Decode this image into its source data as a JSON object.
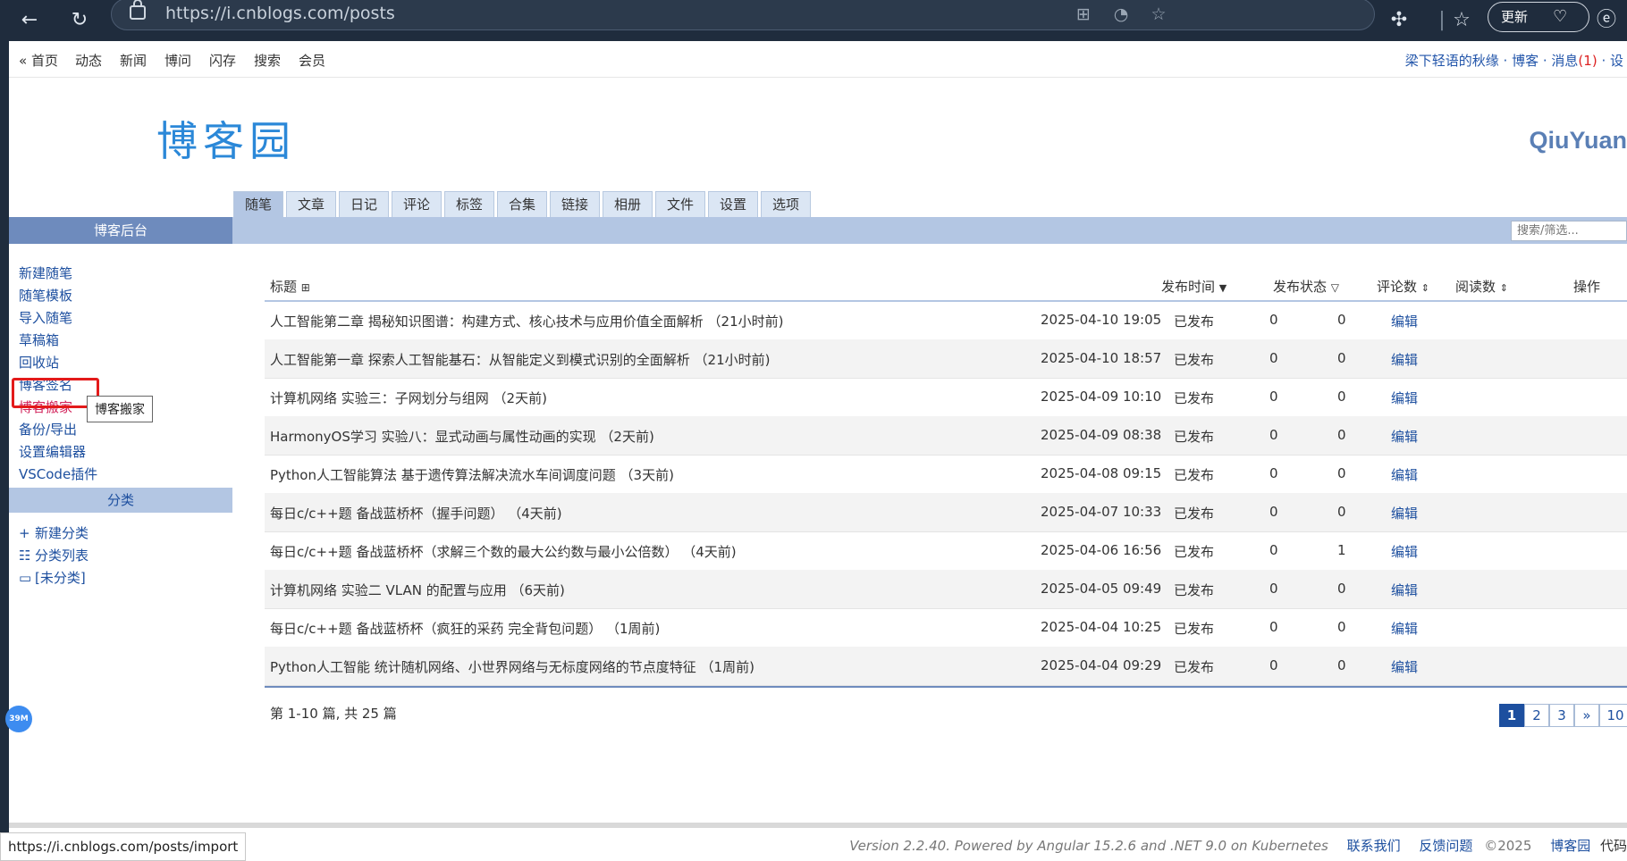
{
  "browser": {
    "url": "https://i.cnblogs.com/posts",
    "update_label": "更新",
    "status_url": "https://i.cnblogs.com/posts/import"
  },
  "topnav": {
    "items": [
      "« 首页",
      "动态",
      "新闻",
      "博问",
      "闪存",
      "搜索",
      "会员"
    ],
    "user": "梁下轻语的秋缘",
    "blog": "博客",
    "messages": "消息",
    "message_count": "(1)",
    "settings": "设"
  },
  "logo": {
    "text": "博客园"
  },
  "blog_name": "QiuYuan",
  "tabs": [
    "随笔",
    "文章",
    "日记",
    "评论",
    "标签",
    "合集",
    "链接",
    "相册",
    "文件",
    "设置",
    "选项"
  ],
  "sidebar": {
    "title": "博客后台",
    "links": [
      "新建随笔",
      "随笔模板",
      "导入随笔",
      "草稿箱",
      "回收站",
      "博客签名",
      "博客搬家",
      "备份/导出",
      "设置编辑器",
      "VSCode插件"
    ],
    "tooltip": "博客搬家",
    "category_title": "分类",
    "category_links": [
      "新建分类",
      "分类列表",
      "[未分类]"
    ],
    "memory_badge": "39M"
  },
  "search": {
    "placeholder": "搜索/筛选..."
  },
  "table": {
    "headers": {
      "title": "标题",
      "date": "发布时间",
      "status": "发布状态",
      "comments": "评论数",
      "reads": "阅读数",
      "action": "操作"
    },
    "rows": [
      {
        "title": "人工智能第二章 揭秘知识图谱：构建方式、核心技术与应用价值全面解析 （21小时前)",
        "date": "2025-04-10 19:05",
        "status": "已发布",
        "comments": "0",
        "reads": "0",
        "action": "编辑"
      },
      {
        "title": "人工智能第一章 探索人工智能基石：从智能定义到模式识别的全面解析 （21小时前)",
        "date": "2025-04-10 18:57",
        "status": "已发布",
        "comments": "0",
        "reads": "0",
        "action": "编辑"
      },
      {
        "title": "计算机网络 实验三：子网划分与组网 （2天前)",
        "date": "2025-04-09 10:10",
        "status": "已发布",
        "comments": "0",
        "reads": "0",
        "action": "编辑"
      },
      {
        "title": "HarmonyOS学习 实验八：显式动画与属性动画的实现 （2天前)",
        "date": "2025-04-09 08:38",
        "status": "已发布",
        "comments": "0",
        "reads": "0",
        "action": "编辑"
      },
      {
        "title": "Python人工智能算法 基于遗传算法解决流水车间调度问题 （3天前)",
        "date": "2025-04-08 09:15",
        "status": "已发布",
        "comments": "0",
        "reads": "0",
        "action": "编辑"
      },
      {
        "title": "每日c/c++题 备战蓝桥杯（握手问题） （4天前)",
        "date": "2025-04-07 10:33",
        "status": "已发布",
        "comments": "0",
        "reads": "0",
        "action": "编辑"
      },
      {
        "title": "每日c/c++题 备战蓝桥杯（求解三个数的最大公约数与最小公倍数） （4天前)",
        "date": "2025-04-06 16:56",
        "status": "已发布",
        "comments": "0",
        "reads": "1",
        "action": "编辑"
      },
      {
        "title": "计算机网络 实验二 VLAN 的配置与应用 （6天前)",
        "date": "2025-04-05 09:49",
        "status": "已发布",
        "comments": "0",
        "reads": "0",
        "action": "编辑"
      },
      {
        "title": "每日c/c++题 备战蓝桥杯（疯狂的采药 完全背包问题） （1周前)",
        "date": "2025-04-04 10:25",
        "status": "已发布",
        "comments": "0",
        "reads": "0",
        "action": "编辑"
      },
      {
        "title": "Python人工智能 统计随机网络、小世界网络与无标度网络的节点度特征 （1周前)",
        "date": "2025-04-04 09:29",
        "status": "已发布",
        "comments": "0",
        "reads": "0",
        "action": "编辑"
      }
    ]
  },
  "pager": {
    "summary": "第 1-10 篇, 共 25 篇",
    "pages": [
      "1",
      "2",
      "3",
      "»",
      "10"
    ],
    "current": "1"
  },
  "footer": {
    "version": "Version 2.2.40. Powered by Angular 15.2.6 and .NET 9.0 on Kubernetes",
    "contact": "联系我们",
    "feedback": "反馈问题",
    "copyright": "©2025",
    "site": "博客园",
    "code": "代码"
  }
}
